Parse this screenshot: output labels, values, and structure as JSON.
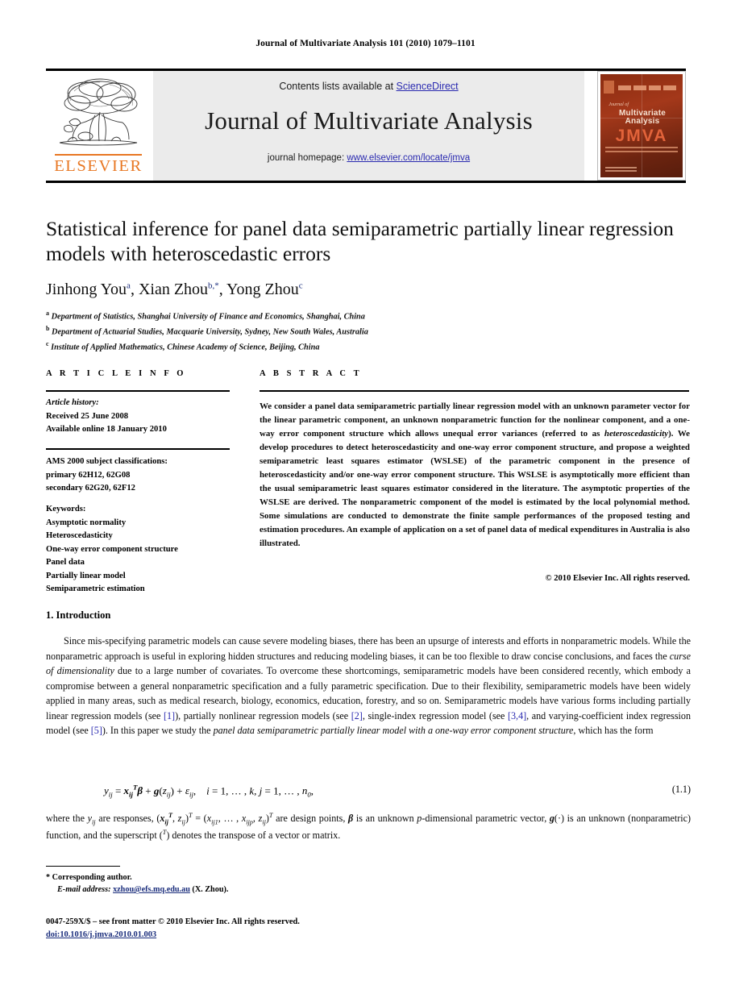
{
  "running_head": "Journal of Multivariate Analysis 101 (2010) 1079–1101",
  "masthead": {
    "contents_prefix": "Contents lists available at ",
    "sciencedirect": "ScienceDirect",
    "journal_name": "Journal of Multivariate Analysis",
    "homepage_prefix": "journal homepage: ",
    "homepage_url": "www.elsevier.com/locate/jmva",
    "publisher": "ELSEVIER",
    "cover": {
      "journal_of": "Journal of",
      "line1": "Multivariate",
      "line2": "Analysis",
      "acronym": "JMVA"
    },
    "link_color": "#2a2ab0",
    "publisher_color": "#E87722",
    "panel_bg": "#ebebeb"
  },
  "article": {
    "title": "Statistical inference for panel data semiparametric partially linear regression models with heteroscedastic errors",
    "authors": [
      {
        "name": "Jinhong You",
        "marks": "a"
      },
      {
        "name": "Xian Zhou",
        "marks": "b,*"
      },
      {
        "name": "Yong Zhou",
        "marks": "c"
      }
    ],
    "affiliations": [
      {
        "mark": "a",
        "text": "Department of Statistics, Shanghai University of Finance and Economics, Shanghai, China"
      },
      {
        "mark": "b",
        "text": "Department of Actuarial Studies, Macquarie University, Sydney, New South Wales, Australia"
      },
      {
        "mark": "c",
        "text": "Institute of Applied Mathematics, Chinese Academy of Science, Beijing, China"
      }
    ]
  },
  "info": {
    "header": "A R T I C L E   I N F O",
    "history_label": "Article history:",
    "received": "Received 25 June 2008",
    "available": "Available online 18 January 2010",
    "ams_label": "AMS 2000 subject classifications:",
    "ams_primary": "primary 62H12, 62G08",
    "ams_secondary": "secondary 62G20, 62F12",
    "keywords_label": "Keywords:",
    "keywords": [
      "Asymptotic normality",
      "Heteroscedasticity",
      "One-way error component structure",
      "Panel data",
      "Partially linear model",
      "Semiparametric estimation"
    ]
  },
  "abstract": {
    "header": "A B S T R A C T",
    "part1": "We consider a panel data semiparametric partially linear regression model with an unknown parameter vector for the linear parametric component, an unknown nonparametric function for the nonlinear component, and a one-way error component structure which allows unequal error variances (referred to as ",
    "emph1": "heteroscedasticity",
    "part2": "). We develop procedures to detect heteroscedasticity and one-way error component structure, and propose a weighted semiparametric least squares estimator (WSLSE) of the parametric component in the presence of heteroscedasticity and/or one-way error component structure. This WSLSE is asymptotically more efficient than the usual semiparametric least squares estimator considered in the literature. The asymptotic properties of the WSLSE are derived. The nonparametric component of the model is estimated by the local polynomial method. Some simulations are conducted to demonstrate the finite sample performances of the proposed testing and estimation procedures. An example of application on a set of panel data of medical expenditures in Australia is also illustrated.",
    "copyright": "© 2010 Elsevier Inc. All rights reserved."
  },
  "introduction": {
    "heading": "1. Introduction",
    "para1_a": "Since mis-specifying parametric models can cause severe modeling biases, there has been an upsurge of interests and efforts in nonparametric models. While the nonparametric approach is useful in exploring hidden structures and reducing modeling biases, it can be too flexible to draw concise conclusions, and faces the ",
    "para1_em1": "curse of dimensionality",
    "para1_b": " due to a large number of covariates. To overcome these shortcomings, semiparametric models have been considered recently, which embody a compromise between a general nonparametric specification and a fully parametric specification. Due to their flexibility, semiparametric models have been widely applied in many areas, such as medical research, biology, economics, education, forestry, and so on. Semiparametric models have various forms including partially linear regression models (see ",
    "ref1": "[1]",
    "para1_c": "), partially nonlinear regression models (see ",
    "ref2": "[2]",
    "para1_d": ", single-index regression model (see ",
    "ref3": "[3,4]",
    "para1_e": ", and varying-coefficient index regression model (see ",
    "ref5": "[5]",
    "para1_f": "). In this paper we study the ",
    "para1_em2": "panel data semiparametric partially linear model with a one-way error component structure",
    "para1_g": ", which has the form",
    "equation_number": "(1.1)",
    "para2_a": "where the ",
    "para2_b": " are responses, ",
    "para2_c": " are design points, ",
    "para2_d": " is an unknown ",
    "para2_e": "-dimensional parametric vector, ",
    "para2_f": " is an unknown (nonparametric) function, and the superscript (",
    "para2_g": ") denotes the transpose of a vector or matrix."
  },
  "footnotes": {
    "corresponding": "* Corresponding author.",
    "email_label": "E-mail address:",
    "email": "xzhou@efs.mq.edu.au",
    "email_suffix": " (X. Zhou).",
    "issn_line": "0047-259X/$ – see front matter © 2010 Elsevier Inc. All rights reserved.",
    "doi": "doi:10.1016/j.jmva.2010.01.003"
  }
}
